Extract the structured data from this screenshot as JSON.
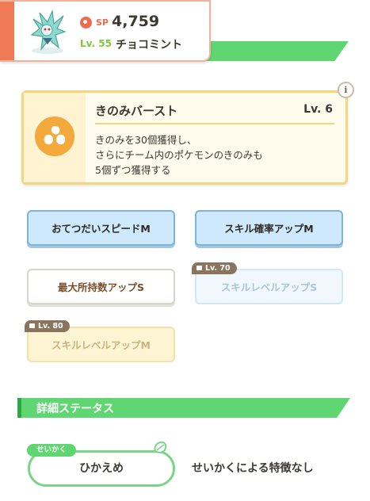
{
  "pokemon": {
    "sp_label": "SP",
    "sp_value": "4,759",
    "level_label": "Lv. 55",
    "name": "チョコミント",
    "sprite_icon": "pokemon-sprite-icon"
  },
  "main_skill": {
    "name": "きのみバースト",
    "level": "Lv. 6",
    "description_lines": [
      "きのみを30個獲得し、",
      "さらにチーム内のポケモンのきのみも",
      "5個ずつ獲得する"
    ],
    "icon": "berry-icon",
    "info_label": "i"
  },
  "sub_skills": [
    {
      "label": "おてつだいスピードM",
      "state": "unlocked"
    },
    {
      "label": "スキル確率アップM",
      "state": "unlocked"
    },
    {
      "label": "最大所持数アップS",
      "state": "unlocked"
    },
    {
      "label": "スキルレベルアップS",
      "state": "locked",
      "unlock_level": "Lv. 70"
    },
    {
      "label": "スキルレベルアップM",
      "state": "locked",
      "unlock_level": "Lv. 80"
    }
  ],
  "detail_status": {
    "heading": "詳細ステータス"
  },
  "nature": {
    "tag": "せいかく",
    "value": "ひかえめ",
    "effect": "せいかくによる特徴なし",
    "icon": "leaf-icon"
  },
  "colors": {
    "accent_green": "#5fd672",
    "accent_orange": "#ee7a56",
    "skill_gold": "#f2d77f",
    "sub_blue": "#cde9fb"
  }
}
